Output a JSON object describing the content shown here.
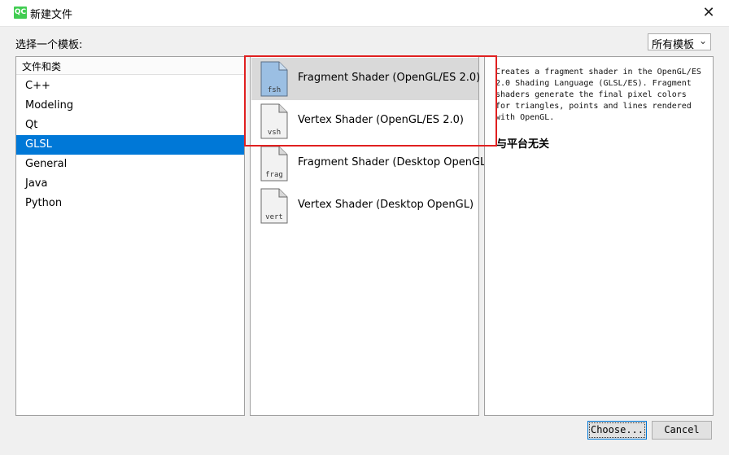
{
  "window": {
    "title": "新建文件",
    "logo": "QC",
    "close_glyph": "✕"
  },
  "choose_template_label": "选择一个模板:",
  "filter": {
    "selected": "所有模板",
    "arrow": "⌄"
  },
  "categories": {
    "header": "文件和类",
    "items": [
      {
        "label": "C++",
        "selected": false
      },
      {
        "label": "Modeling",
        "selected": false
      },
      {
        "label": "Qt",
        "selected": false
      },
      {
        "label": "GLSL",
        "selected": true
      },
      {
        "label": "General",
        "selected": false
      },
      {
        "label": "Java",
        "selected": false
      },
      {
        "label": "Python",
        "selected": false
      }
    ]
  },
  "templates": [
    {
      "label": "Fragment Shader (OpenGL/ES 2.0)",
      "icon_text": "fsh",
      "icon": "file-fsh-icon",
      "selected": true
    },
    {
      "label": "Vertex Shader (OpenGL/ES 2.0)",
      "icon_text": "vsh",
      "icon": "file-vsh-icon",
      "selected": false
    },
    {
      "label": "Fragment Shader (Desktop OpenGL)",
      "icon_text": "frag",
      "icon": "file-frag-icon",
      "selected": false
    },
    {
      "label": "Vertex Shader (Desktop OpenGL)",
      "icon_text": "vert",
      "icon": "file-vert-icon",
      "selected": false
    }
  ],
  "description": {
    "lines": [
      "Creates a fragment shader in the OpenGL/ES",
      "2.0 Shading Language (GLSL/ES). Fragment",
      "shaders generate the final pixel colors",
      "for triangles, points and lines rendered",
      "with OpenGL."
    ],
    "platform": "与平台无关"
  },
  "buttons": {
    "choose": "Choose...",
    "cancel": "Cancel"
  },
  "colors": {
    "selection": "#0078d7",
    "template_selected": "#d9d9d9",
    "highlight": "#e02020",
    "logo": "#41cd52"
  }
}
